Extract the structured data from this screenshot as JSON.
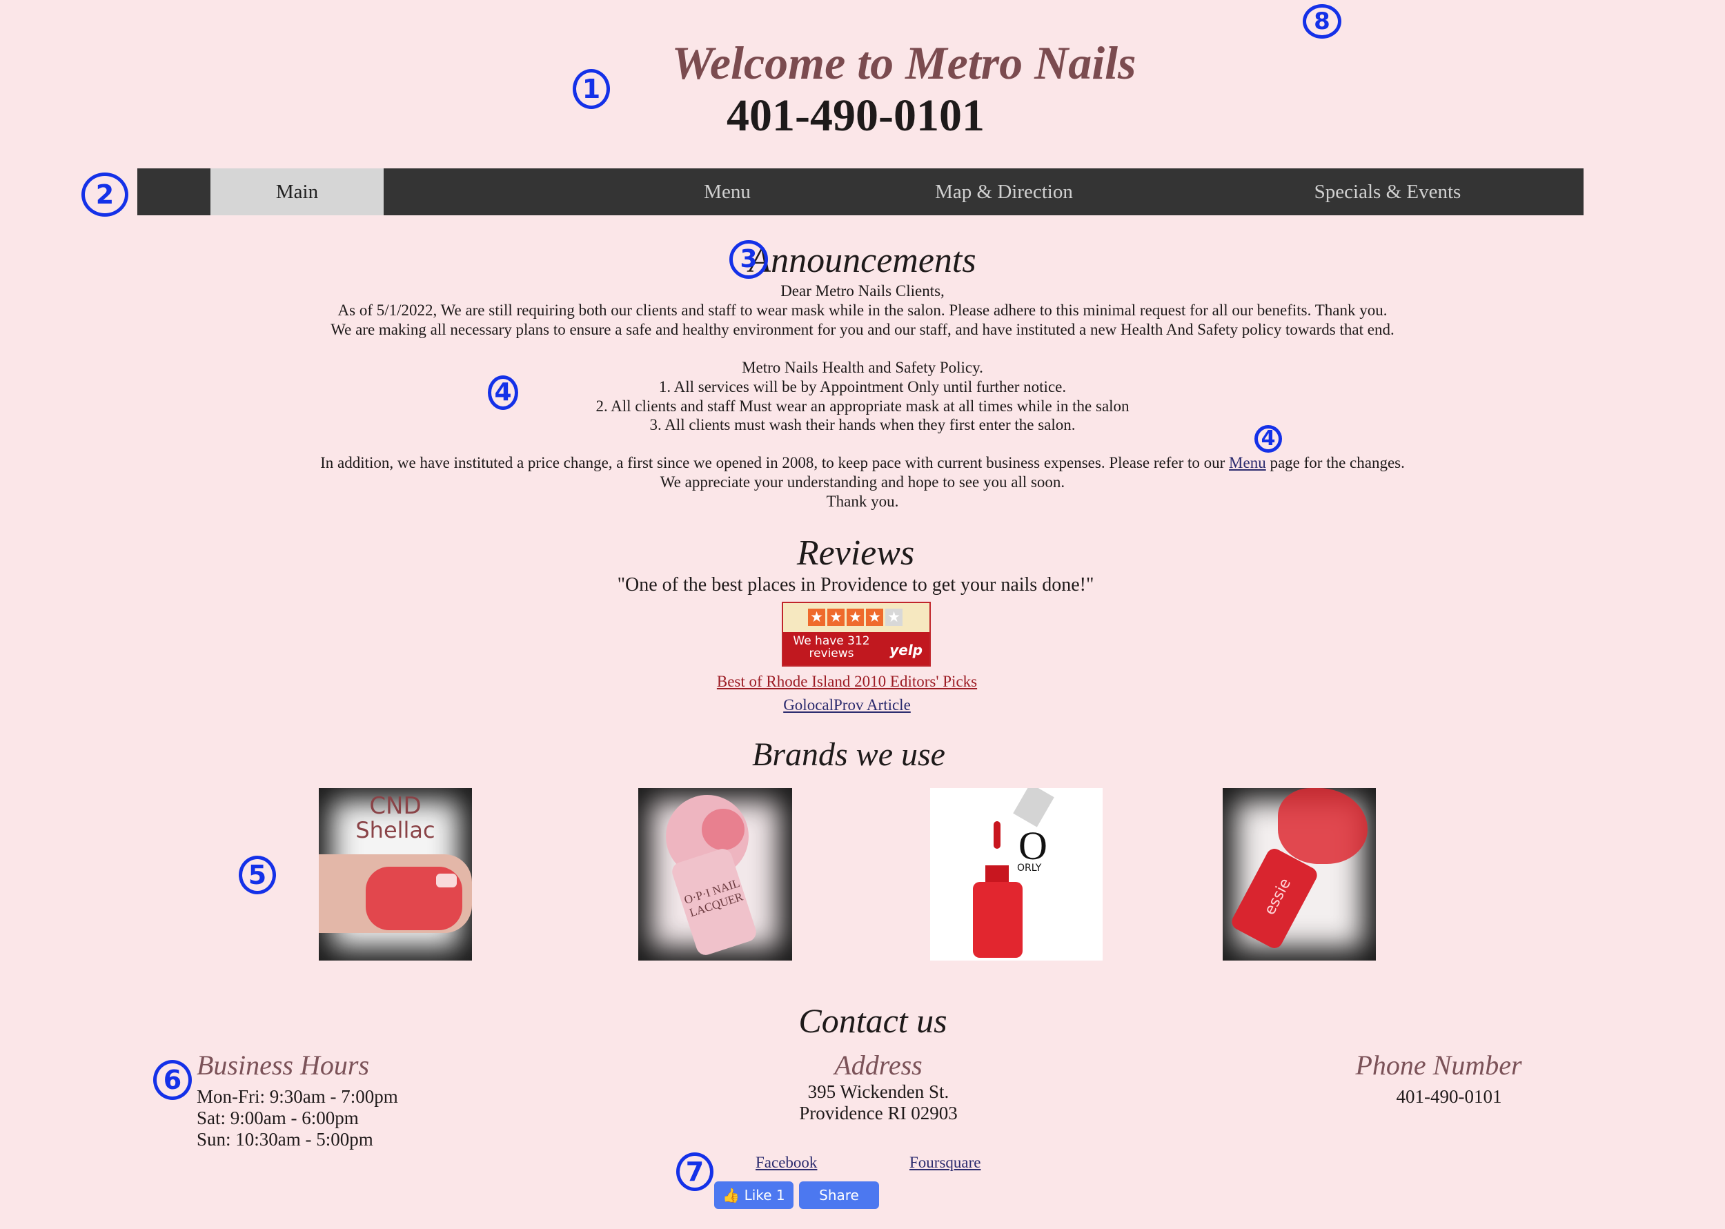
{
  "header": {
    "title": "Welcome to Metro Nails",
    "phone": "401-490-0101"
  },
  "nav": {
    "items": [
      {
        "label": "Main"
      },
      {
        "label": "Menu"
      },
      {
        "label": "Map & Direction"
      },
      {
        "label": "Specials & Events"
      }
    ]
  },
  "announcements": {
    "heading": "Announcements",
    "greeting": "Dear Metro Nails Clients,",
    "line1": "As of 5/1/2022, We are still requiring both our clients and staff  to wear mask while in the salon. Please adhere to this minimal request for all our benefits. Thank you.",
    "line2": "We are making all necessary plans to ensure a safe and healthy environment for you and our staff, and have instituted a new Health And Safety policy towards that end.",
    "policy_title": "Metro Nails Health and Safety Policy.",
    "policy_items": [
      "1.   All services will be by Appointment Only until further notice.",
      "2.   All clients and staff Must wear an appropriate mask at all times while in the salon",
      "3.   All clients must wash their hands  when they first enter the salon."
    ],
    "price_before": "In addition, we have instituted a price change, a first since we opened in 2008, to keep pace with current business expenses. Please refer to our ",
    "price_link": "Menu",
    "price_after": " page for the changes.",
    "appreciate": "We appreciate your understanding and hope to see you all soon.",
    "thanks": "Thank you."
  },
  "reviews": {
    "heading": "Reviews",
    "quote": "\"One of the best places in Providence to get your nails done!\"",
    "yelp": {
      "rating": 4,
      "max_rating": 5,
      "text": "We have 312 reviews",
      "logo": "yelp"
    },
    "link1": "Best of Rhode Island 2010 Editors' Picks",
    "link2": "GolocalProv Article"
  },
  "brands": {
    "heading": "Brands we use",
    "cnd_text1": "CND",
    "cnd_text2": "Shellac",
    "opi_text": "O·P·I NAIL LACQUER",
    "orly_text": "ORLY",
    "essie_text": "essie"
  },
  "contact": {
    "heading": "Contact us",
    "hours_title": "Business Hours",
    "hours": [
      "Mon-Fri: 9:30am - 7:00pm",
      "Sat: 9:00am - 6:00pm",
      "Sun: 10:30am - 5:00pm"
    ],
    "address_title": "Address",
    "address": [
      "395 Wickenden St.",
      "Providence RI 02903"
    ],
    "phone_title": "Phone Number",
    "phone": "401-490-0101"
  },
  "social": {
    "facebook": "Facebook",
    "foursquare": "Foursquare",
    "like_label": "Like 1",
    "share_label": "Share"
  },
  "annotations": [
    "1",
    "2",
    "3",
    "4",
    "4",
    "5",
    "6",
    "7",
    "8"
  ],
  "colors": {
    "background": "#fbe6e8",
    "nav": "#343434",
    "title": "#7b4b4f",
    "annotation": "#1431e8",
    "facebook": "#4c78f0"
  }
}
